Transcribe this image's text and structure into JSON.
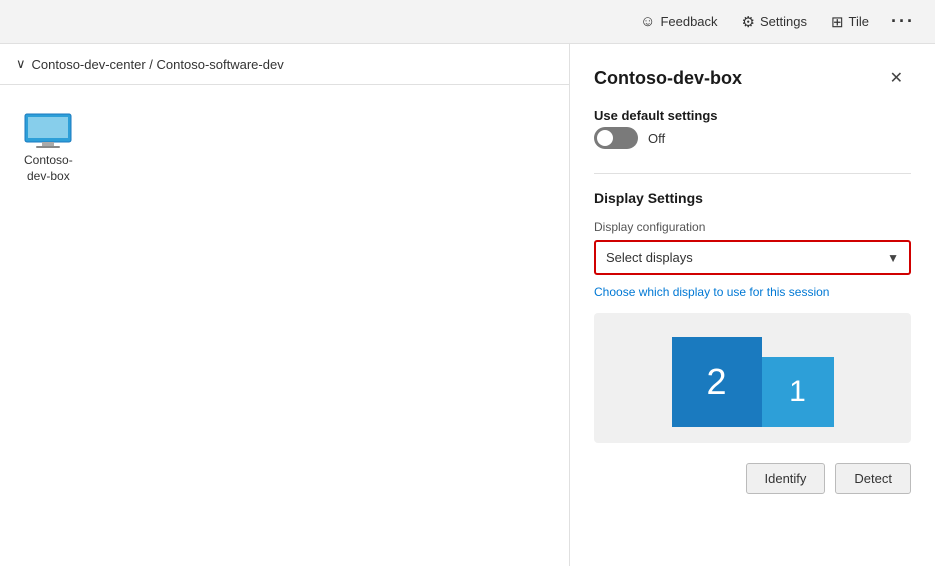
{
  "topbar": {
    "feedback_label": "Feedback",
    "settings_label": "Settings",
    "tile_label": "Tile",
    "more_label": "···"
  },
  "breadcrumb": {
    "chevron": "∨",
    "path": "Contoso-dev-center / Contoso-software-dev"
  },
  "devbox": {
    "label_line1": "Contoso-",
    "label_line2": "dev-box"
  },
  "side_panel": {
    "title": "Contoso-dev-box",
    "close_label": "✕",
    "use_default_label": "Use default settings",
    "toggle_state": "Off",
    "display_settings_label": "Display Settings",
    "display_config_label": "Display configuration",
    "select_placeholder": "Select displays",
    "helper_text": "Choose which display to use for this session",
    "monitor_2_label": "2",
    "monitor_1_label": "1",
    "identify_label": "Identify",
    "detect_label": "Detect"
  }
}
